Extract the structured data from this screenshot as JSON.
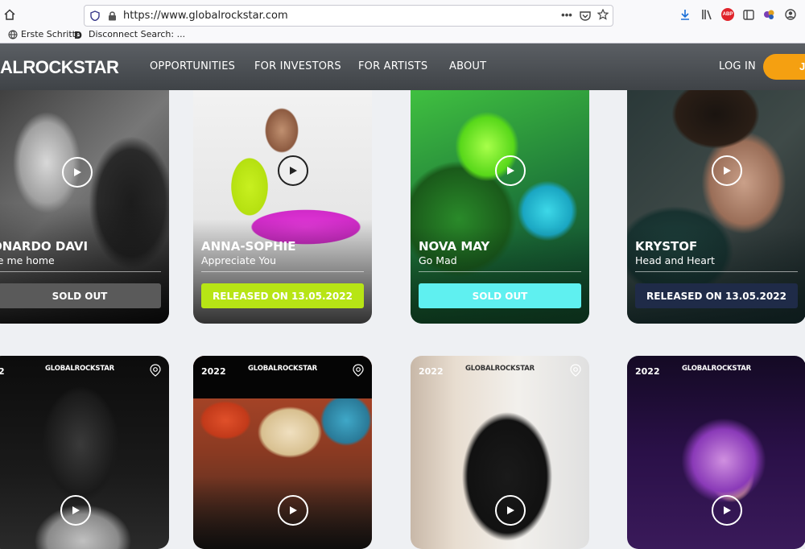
{
  "browser": {
    "url": "https://www.globalrockstar.com",
    "bookmarks": [
      "Erste Schritte",
      "Disconnect Search: ..."
    ],
    "abp_label": "ABP"
  },
  "header": {
    "logo": "ALROCKSTAR",
    "nav": [
      "OPPORTUNITIES",
      "FOR INVESTORS",
      "FOR ARTISTS",
      "ABOUT"
    ],
    "login": "LOG IN",
    "join_partial": "J"
  },
  "cards_row1": [
    {
      "artist": "ONARDO DAVI",
      "song": "ke me home",
      "status": "SOLD OUT",
      "status_color": "#5a5a5a"
    },
    {
      "artist": "ANNA-SOPHIE",
      "song": "Appreciate You",
      "status": "RELEASED ON 13.05.2022",
      "status_color": "#b7e515"
    },
    {
      "artist": "NOVA MAY",
      "song": "Go Mad",
      "status": "SOLD OUT",
      "status_color": "#5ff0f0"
    },
    {
      "artist": "KRYSTOF",
      "song": "Head and Heart",
      "status": "RELEASED ON 13.05.2022",
      "status_color": "#1f2b48"
    }
  ],
  "cards_row2": [
    {
      "year": "2",
      "brand": "GLOBALROCKSTAR"
    },
    {
      "year": "2022",
      "brand": "GLOBALROCKSTAR"
    },
    {
      "year": "2022",
      "brand": "GLOBALROCKSTAR"
    },
    {
      "year": "2022",
      "brand": "GLOBALROCKSTAR"
    }
  ],
  "colors": {
    "accent": "#f5a011",
    "header_bg": "#4a4e52"
  },
  "icons": [
    "home-icon",
    "shield-icon",
    "lock-icon",
    "more-icon",
    "pocket-icon",
    "star-icon",
    "download-icon",
    "library-icon",
    "sidebar-icon",
    "extensions-icon",
    "account-icon",
    "play-icon",
    "location-pin-icon"
  ]
}
